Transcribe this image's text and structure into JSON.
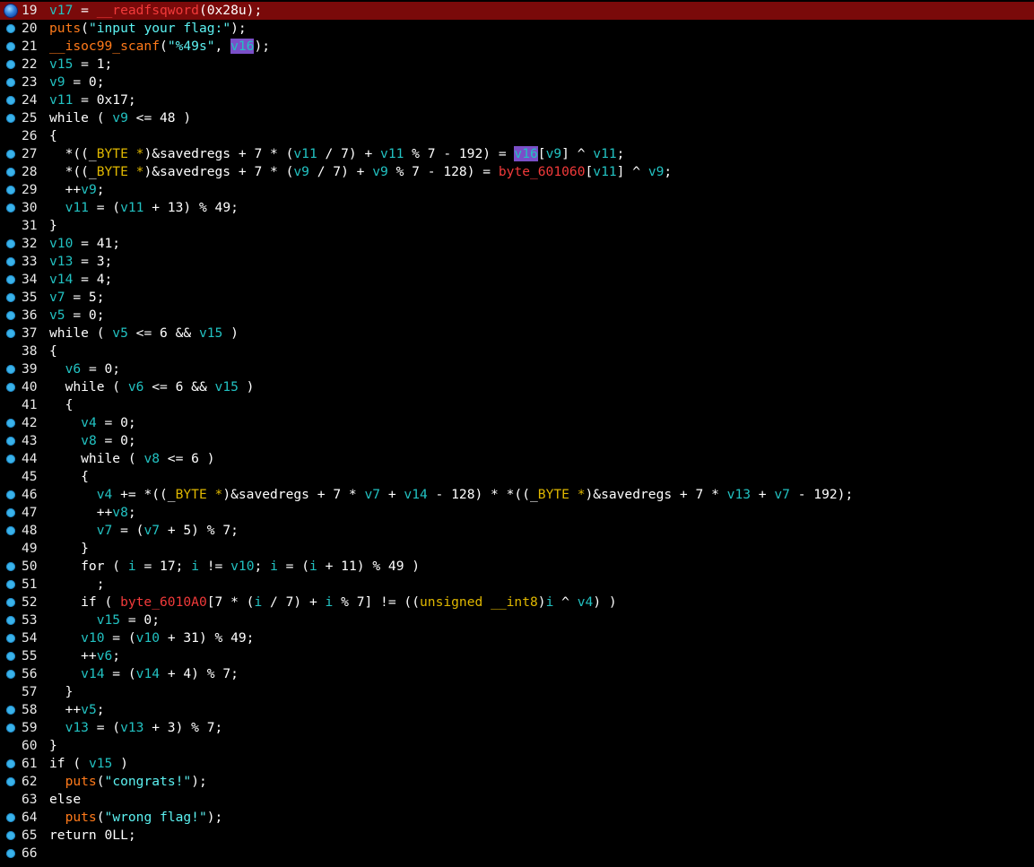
{
  "editor": {
    "current_line": 19,
    "highlighted_token": "v16",
    "lines": [
      {
        "n": "19",
        "bp": "cur",
        "current": true,
        "segs": [
          [
            "v",
            "v17"
          ],
          [
            "p",
            " = "
          ],
          [
            "r",
            "__readfsqword"
          ],
          [
            "p",
            "(0x28u);"
          ]
        ]
      },
      {
        "n": "20",
        "bp": "bp",
        "segs": [
          [
            "f",
            "puts"
          ],
          [
            "p",
            "("
          ],
          [
            "s",
            "\"input your flag:\""
          ],
          [
            "p",
            ");"
          ]
        ]
      },
      {
        "n": "21",
        "bp": "bp",
        "segs": [
          [
            "f",
            "__isoc99_scanf"
          ],
          [
            "p",
            "("
          ],
          [
            "s",
            "\"%49s\""
          ],
          [
            "p",
            ", "
          ],
          [
            "hl",
            "v16"
          ],
          [
            "p",
            ");"
          ]
        ]
      },
      {
        "n": "22",
        "bp": "bp",
        "segs": [
          [
            "v",
            "v15"
          ],
          [
            "p",
            " = 1;"
          ]
        ]
      },
      {
        "n": "23",
        "bp": "bp",
        "segs": [
          [
            "v",
            "v9"
          ],
          [
            "p",
            " = 0;"
          ]
        ]
      },
      {
        "n": "24",
        "bp": "bp",
        "segs": [
          [
            "v",
            "v11"
          ],
          [
            "p",
            " = 0x17;"
          ]
        ]
      },
      {
        "n": "25",
        "bp": "bp",
        "segs": [
          [
            "p",
            "while ( "
          ],
          [
            "v",
            "v9"
          ],
          [
            "p",
            " <= 48 )"
          ]
        ]
      },
      {
        "n": "26",
        "bp": "",
        "segs": [
          [
            "p",
            "{"
          ]
        ]
      },
      {
        "n": "27",
        "bp": "bp",
        "segs": [
          [
            "p",
            "  *((_"
          ],
          [
            "t",
            "BYTE *"
          ],
          [
            "p",
            ")&savedregs + 7 * ("
          ],
          [
            "v",
            "v11"
          ],
          [
            "p",
            " / 7) + "
          ],
          [
            "v",
            "v11"
          ],
          [
            "p",
            " % 7 - 192) = "
          ],
          [
            "hl",
            "v16"
          ],
          [
            "p",
            "["
          ],
          [
            "v",
            "v9"
          ],
          [
            "p",
            "] ^ "
          ],
          [
            "v",
            "v11"
          ],
          [
            "p",
            ";"
          ]
        ]
      },
      {
        "n": "28",
        "bp": "bp",
        "segs": [
          [
            "p",
            "  *((_"
          ],
          [
            "t",
            "BYTE *"
          ],
          [
            "p",
            ")&savedregs + 7 * ("
          ],
          [
            "v",
            "v9"
          ],
          [
            "p",
            " / 7) + "
          ],
          [
            "v",
            "v9"
          ],
          [
            "p",
            " % 7 - 128) = "
          ],
          [
            "r",
            "byte_601060"
          ],
          [
            "p",
            "["
          ],
          [
            "v",
            "v11"
          ],
          [
            "p",
            "] ^ "
          ],
          [
            "v",
            "v9"
          ],
          [
            "p",
            ";"
          ]
        ]
      },
      {
        "n": "29",
        "bp": "bp",
        "segs": [
          [
            "p",
            "  ++"
          ],
          [
            "v",
            "v9"
          ],
          [
            "p",
            ";"
          ]
        ]
      },
      {
        "n": "30",
        "bp": "bp",
        "segs": [
          [
            "p",
            "  "
          ],
          [
            "v",
            "v11"
          ],
          [
            "p",
            " = ("
          ],
          [
            "v",
            "v11"
          ],
          [
            "p",
            " + 13) % 49;"
          ]
        ]
      },
      {
        "n": "31",
        "bp": "",
        "segs": [
          [
            "p",
            "}"
          ]
        ]
      },
      {
        "n": "32",
        "bp": "bp",
        "segs": [
          [
            "v",
            "v10"
          ],
          [
            "p",
            " = 41;"
          ]
        ]
      },
      {
        "n": "33",
        "bp": "bp",
        "segs": [
          [
            "v",
            "v13"
          ],
          [
            "p",
            " = 3;"
          ]
        ]
      },
      {
        "n": "34",
        "bp": "bp",
        "segs": [
          [
            "v",
            "v14"
          ],
          [
            "p",
            " = 4;"
          ]
        ]
      },
      {
        "n": "35",
        "bp": "bp",
        "segs": [
          [
            "v",
            "v7"
          ],
          [
            "p",
            " = 5;"
          ]
        ]
      },
      {
        "n": "36",
        "bp": "bp",
        "segs": [
          [
            "v",
            "v5"
          ],
          [
            "p",
            " = 0;"
          ]
        ]
      },
      {
        "n": "37",
        "bp": "bp",
        "segs": [
          [
            "p",
            "while ( "
          ],
          [
            "v",
            "v5"
          ],
          [
            "p",
            " <= 6 && "
          ],
          [
            "v",
            "v15"
          ],
          [
            "p",
            " )"
          ]
        ]
      },
      {
        "n": "38",
        "bp": "",
        "segs": [
          [
            "p",
            "{"
          ]
        ]
      },
      {
        "n": "39",
        "bp": "bp",
        "segs": [
          [
            "p",
            "  "
          ],
          [
            "v",
            "v6"
          ],
          [
            "p",
            " = 0;"
          ]
        ]
      },
      {
        "n": "40",
        "bp": "bp",
        "segs": [
          [
            "p",
            "  while ( "
          ],
          [
            "v",
            "v6"
          ],
          [
            "p",
            " <= 6 && "
          ],
          [
            "v",
            "v15"
          ],
          [
            "p",
            " )"
          ]
        ]
      },
      {
        "n": "41",
        "bp": "",
        "segs": [
          [
            "p",
            "  {"
          ]
        ]
      },
      {
        "n": "42",
        "bp": "bp",
        "segs": [
          [
            "p",
            "    "
          ],
          [
            "v",
            "v4"
          ],
          [
            "p",
            " = 0;"
          ]
        ]
      },
      {
        "n": "43",
        "bp": "bp",
        "segs": [
          [
            "p",
            "    "
          ],
          [
            "v",
            "v8"
          ],
          [
            "p",
            " = 0;"
          ]
        ]
      },
      {
        "n": "44",
        "bp": "bp",
        "segs": [
          [
            "p",
            "    while ( "
          ],
          [
            "v",
            "v8"
          ],
          [
            "p",
            " <= 6 )"
          ]
        ]
      },
      {
        "n": "45",
        "bp": "",
        "segs": [
          [
            "p",
            "    {"
          ]
        ]
      },
      {
        "n": "46",
        "bp": "bp",
        "segs": [
          [
            "p",
            "      "
          ],
          [
            "v",
            "v4"
          ],
          [
            "p",
            " += *((_"
          ],
          [
            "t",
            "BYTE *"
          ],
          [
            "p",
            ")&savedregs + 7 * "
          ],
          [
            "v",
            "v7"
          ],
          [
            "p",
            " + "
          ],
          [
            "v",
            "v14"
          ],
          [
            "p",
            " - 128) * *((_"
          ],
          [
            "t",
            "BYTE *"
          ],
          [
            "p",
            ")&savedregs + 7 * "
          ],
          [
            "v",
            "v13"
          ],
          [
            "p",
            " + "
          ],
          [
            "v",
            "v7"
          ],
          [
            "p",
            " - 192);"
          ]
        ]
      },
      {
        "n": "47",
        "bp": "bp",
        "segs": [
          [
            "p",
            "      ++"
          ],
          [
            "v",
            "v8"
          ],
          [
            "p",
            ";"
          ]
        ]
      },
      {
        "n": "48",
        "bp": "bp",
        "segs": [
          [
            "p",
            "      "
          ],
          [
            "v",
            "v7"
          ],
          [
            "p",
            " = ("
          ],
          [
            "v",
            "v7"
          ],
          [
            "p",
            " + 5) % 7;"
          ]
        ]
      },
      {
        "n": "49",
        "bp": "",
        "segs": [
          [
            "p",
            "    }"
          ]
        ]
      },
      {
        "n": "50",
        "bp": "bp",
        "segs": [
          [
            "p",
            "    for ( "
          ],
          [
            "v",
            "i"
          ],
          [
            "p",
            " = 17; "
          ],
          [
            "v",
            "i"
          ],
          [
            "p",
            " != "
          ],
          [
            "v",
            "v10"
          ],
          [
            "p",
            "; "
          ],
          [
            "v",
            "i"
          ],
          [
            "p",
            " = ("
          ],
          [
            "v",
            "i"
          ],
          [
            "p",
            " + 11) % 49 )"
          ]
        ]
      },
      {
        "n": "51",
        "bp": "bp",
        "segs": [
          [
            "p",
            "      ;"
          ]
        ]
      },
      {
        "n": "52",
        "bp": "bp",
        "segs": [
          [
            "p",
            "    if ( "
          ],
          [
            "r",
            "byte_6010A0"
          ],
          [
            "p",
            "[7 * ("
          ],
          [
            "v",
            "i"
          ],
          [
            "p",
            " / 7) + "
          ],
          [
            "v",
            "i"
          ],
          [
            "p",
            " % 7] != (("
          ],
          [
            "t",
            "unsigned __int8"
          ],
          [
            "p",
            ")"
          ],
          [
            "v",
            "i"
          ],
          [
            "p",
            " ^ "
          ],
          [
            "v",
            "v4"
          ],
          [
            "p",
            ") )"
          ]
        ]
      },
      {
        "n": "53",
        "bp": "bp",
        "segs": [
          [
            "p",
            "      "
          ],
          [
            "v",
            "v15"
          ],
          [
            "p",
            " = 0;"
          ]
        ]
      },
      {
        "n": "54",
        "bp": "bp",
        "segs": [
          [
            "p",
            "    "
          ],
          [
            "v",
            "v10"
          ],
          [
            "p",
            " = ("
          ],
          [
            "v",
            "v10"
          ],
          [
            "p",
            " + 31) % 49;"
          ]
        ]
      },
      {
        "n": "55",
        "bp": "bp",
        "segs": [
          [
            "p",
            "    ++"
          ],
          [
            "v",
            "v6"
          ],
          [
            "p",
            ";"
          ]
        ]
      },
      {
        "n": "56",
        "bp": "bp",
        "segs": [
          [
            "p",
            "    "
          ],
          [
            "v",
            "v14"
          ],
          [
            "p",
            " = ("
          ],
          [
            "v",
            "v14"
          ],
          [
            "p",
            " + 4) % 7;"
          ]
        ]
      },
      {
        "n": "57",
        "bp": "",
        "segs": [
          [
            "p",
            "  }"
          ]
        ]
      },
      {
        "n": "58",
        "bp": "bp",
        "segs": [
          [
            "p",
            "  ++"
          ],
          [
            "v",
            "v5"
          ],
          [
            "p",
            ";"
          ]
        ]
      },
      {
        "n": "59",
        "bp": "bp",
        "segs": [
          [
            "p",
            "  "
          ],
          [
            "v",
            "v13"
          ],
          [
            "p",
            " = ("
          ],
          [
            "v",
            "v13"
          ],
          [
            "p",
            " + 3) % 7;"
          ]
        ]
      },
      {
        "n": "60",
        "bp": "",
        "segs": [
          [
            "p",
            "}"
          ]
        ]
      },
      {
        "n": "61",
        "bp": "bp",
        "segs": [
          [
            "p",
            "if ( "
          ],
          [
            "v",
            "v15"
          ],
          [
            "p",
            " )"
          ]
        ]
      },
      {
        "n": "62",
        "bp": "bp",
        "segs": [
          [
            "p",
            "  "
          ],
          [
            "f",
            "puts"
          ],
          [
            "p",
            "("
          ],
          [
            "s",
            "\"congrats!\""
          ],
          [
            "p",
            ");"
          ]
        ]
      },
      {
        "n": "63",
        "bp": "",
        "segs": [
          [
            "p",
            "else"
          ]
        ]
      },
      {
        "n": "64",
        "bp": "bp",
        "segs": [
          [
            "p",
            "  "
          ],
          [
            "f",
            "puts"
          ],
          [
            "p",
            "("
          ],
          [
            "s",
            "\"wrong flag!\""
          ],
          [
            "p",
            ");"
          ]
        ]
      },
      {
        "n": "65",
        "bp": "bp",
        "segs": [
          [
            "p",
            "return 0LL;"
          ]
        ]
      },
      {
        "n": "66",
        "bp": "bp",
        "segs": []
      }
    ]
  }
}
